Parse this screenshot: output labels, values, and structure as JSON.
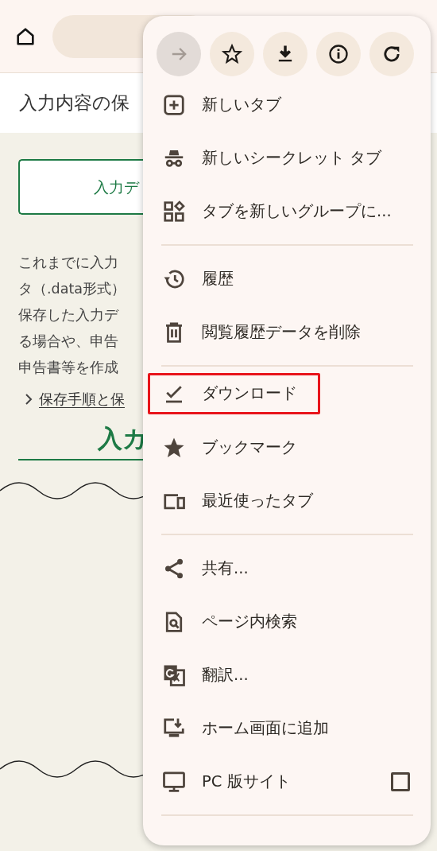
{
  "page": {
    "title": "入力内容の保",
    "button": "入力デ",
    "paragraph_lines": [
      "これまでに入力",
      "タ（.data形式）",
      "保存した入力デ",
      "る場合や、申告",
      "申告書等を作成"
    ],
    "link": "保存手順と保",
    "heading": "入カ"
  },
  "menu": {
    "toolbar": [
      {
        "kind": "forward",
        "disabled": true
      },
      {
        "kind": "star",
        "disabled": false
      },
      {
        "kind": "download",
        "disabled": false
      },
      {
        "kind": "info",
        "disabled": false
      },
      {
        "kind": "reload",
        "disabled": false
      }
    ],
    "groups": [
      [
        {
          "kind": "newtab",
          "label": "新しいタブ",
          "highlighted": false
        },
        {
          "kind": "incognito",
          "label": "新しいシークレット タブ",
          "highlighted": false
        },
        {
          "kind": "group",
          "label": "タブを新しいグループに...",
          "highlighted": false
        }
      ],
      [
        {
          "kind": "history",
          "label": "履歴",
          "highlighted": false
        },
        {
          "kind": "trash",
          "label": "閲覧履歴データを削除",
          "highlighted": false
        }
      ],
      [
        {
          "kind": "downloads",
          "label": "ダウンロード",
          "highlighted": true
        },
        {
          "kind": "bookmark",
          "label": "ブックマーク",
          "highlighted": false
        },
        {
          "kind": "devices",
          "label": "最近使ったタブ",
          "highlighted": false
        }
      ],
      [
        {
          "kind": "share",
          "label": "共有...",
          "highlighted": false
        },
        {
          "kind": "findpage",
          "label": "ページ内検索",
          "highlighted": false
        },
        {
          "kind": "translate",
          "label": "翻訳...",
          "highlighted": false
        },
        {
          "kind": "homescreen",
          "label": "ホーム画面に追加",
          "highlighted": false
        },
        {
          "kind": "desktop",
          "label": "PC 版サイト",
          "highlighted": false,
          "checked": false
        }
      ]
    ]
  }
}
